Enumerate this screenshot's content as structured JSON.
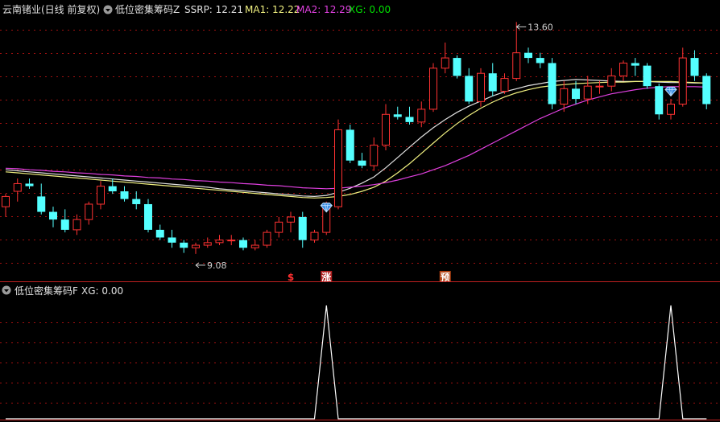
{
  "main_header": {
    "stock": "云南锗业(日线 前复权)",
    "indicator": "低位密集筹码Z",
    "items": [
      {
        "label": "SSRP: 12.21",
        "color": "#e0e0e0"
      },
      {
        "label": "MA1: 12.22",
        "color": "#f0f080"
      },
      {
        "label": "MA2: 12.29",
        "color": "#e040e0"
      },
      {
        "label": "XG: 0.00",
        "color": "#00e000"
      }
    ]
  },
  "sub_header": {
    "indicator": "低位密集筹码F",
    "items": [
      {
        "label": "XG: 0.00",
        "color": "#e0e0e0"
      }
    ]
  },
  "colors": {
    "up": "#ff3232",
    "down": "#54ffff",
    "ma1": "#f0f080",
    "ma2": "#e040e0",
    "ssrp": "#e0e0e0",
    "grid": "#a01010",
    "signal": "#ffffff"
  },
  "annotations": {
    "low": "9.08",
    "high": "13.60",
    "low_index": 16,
    "high_index": 43
  },
  "markers": [
    {
      "text": "$",
      "index": 24,
      "color": "#ff3030"
    },
    {
      "text": "涨",
      "index": 27,
      "color": "#ffffff",
      "bg": "#b02020"
    },
    {
      "text": "预",
      "index": 37,
      "color": "#ffffff",
      "bg": "#b04010"
    }
  ],
  "chart_data": [
    {
      "type": "candlestick",
      "x": [
        0,
        1,
        2,
        3,
        4,
        5,
        6,
        7,
        8,
        9,
        10,
        11,
        12,
        13,
        14,
        15,
        16,
        17,
        18,
        19,
        20,
        21,
        22,
        23,
        24,
        25,
        26,
        27,
        28,
        29,
        30,
        31,
        32,
        33,
        34,
        35,
        36,
        37,
        38,
        39,
        40,
        41,
        42,
        43,
        44,
        45,
        46,
        47,
        48,
        49,
        50,
        51,
        52,
        53,
        54,
        55,
        56,
        57,
        58,
        59
      ],
      "open": [
        10.0,
        10.3,
        10.45,
        10.2,
        9.9,
        9.75,
        9.55,
        9.75,
        10.05,
        10.4,
        10.3,
        10.15,
        10.05,
        9.55,
        9.4,
        9.3,
        9.2,
        9.25,
        9.3,
        9.35,
        9.35,
        9.2,
        9.25,
        9.5,
        9.7,
        9.8,
        9.35,
        9.5,
        10.0,
        11.5,
        10.9,
        10.8,
        11.2,
        11.8,
        11.75,
        11.65,
        11.9,
        12.7,
        12.9,
        12.55,
        12.05,
        12.6,
        12.25,
        12.5,
        13.0,
        12.9,
        12.8,
        12.0,
        12.3,
        12.1,
        12.35,
        12.35,
        12.55,
        12.8,
        12.75,
        12.35,
        11.8,
        12.0,
        12.9,
        12.55
      ],
      "close": [
        10.2,
        10.45,
        10.4,
        9.9,
        9.75,
        9.55,
        9.75,
        10.05,
        10.4,
        10.3,
        10.15,
        10.05,
        9.55,
        9.4,
        9.3,
        9.2,
        9.25,
        9.3,
        9.35,
        9.35,
        9.2,
        9.25,
        9.5,
        9.7,
        9.8,
        9.35,
        9.5,
        10.0,
        11.5,
        10.9,
        10.8,
        11.2,
        11.8,
        11.75,
        11.65,
        11.9,
        12.7,
        12.9,
        12.55,
        12.05,
        12.6,
        12.25,
        12.5,
        13.0,
        12.9,
        12.8,
        12.0,
        12.3,
        12.1,
        12.35,
        12.35,
        12.55,
        12.8,
        12.75,
        12.35,
        11.8,
        12.0,
        12.9,
        12.55,
        12.0
      ],
      "high": [
        10.25,
        10.55,
        10.55,
        10.45,
        10.0,
        9.95,
        9.85,
        10.1,
        10.5,
        10.55,
        10.4,
        10.3,
        10.15,
        9.65,
        9.55,
        9.35,
        9.3,
        9.4,
        9.45,
        9.45,
        9.4,
        9.35,
        9.55,
        9.8,
        9.9,
        9.9,
        9.55,
        10.1,
        11.7,
        11.6,
        11.05,
        11.35,
        12.0,
        11.95,
        11.95,
        12.05,
        12.8,
        13.2,
        12.95,
        12.7,
        12.7,
        12.8,
        12.6,
        13.6,
        13.1,
        13.0,
        12.9,
        12.45,
        12.45,
        12.55,
        12.45,
        12.7,
        12.85,
        12.9,
        12.8,
        12.4,
        12.1,
        13.1,
        13.05,
        12.6
      ],
      "low": [
        9.8,
        10.1,
        10.35,
        9.85,
        9.6,
        9.5,
        9.45,
        9.65,
        9.95,
        10.25,
        10.1,
        9.95,
        9.5,
        9.35,
        9.2,
        9.1,
        9.08,
        9.2,
        9.25,
        9.25,
        9.15,
        9.15,
        9.2,
        9.4,
        9.5,
        9.2,
        9.3,
        9.45,
        9.95,
        10.85,
        10.75,
        10.7,
        11.1,
        11.7,
        11.6,
        11.55,
        11.85,
        12.6,
        12.5,
        12.0,
        11.95,
        12.15,
        12.2,
        12.45,
        12.8,
        12.7,
        11.9,
        11.85,
        12.0,
        12.0,
        12.2,
        12.25,
        12.45,
        12.55,
        12.3,
        11.7,
        11.7,
        11.95,
        12.45,
        11.9
      ]
    },
    {
      "type": "line",
      "x": [
        0,
        1,
        2,
        3,
        4,
        5,
        6,
        7,
        8,
        9,
        10,
        11,
        12,
        13,
        14,
        15,
        16,
        17,
        18,
        19,
        20,
        21,
        22,
        23,
        24,
        25,
        26,
        27,
        28,
        29,
        30,
        31,
        32,
        33,
        34,
        35,
        36,
        37,
        38,
        39,
        40,
        41,
        42,
        43,
        44,
        45,
        46,
        47,
        48,
        49,
        50,
        51,
        52,
        53,
        54,
        55,
        56,
        57,
        58,
        59
      ],
      "series": [
        {
          "name": "SSRP",
          "values": [
            10.72,
            10.7,
            10.68,
            10.66,
            10.64,
            10.62,
            10.6,
            10.58,
            10.56,
            10.54,
            10.52,
            10.5,
            10.48,
            10.46,
            10.44,
            10.42,
            10.4,
            10.38,
            10.35,
            10.33,
            10.31,
            10.29,
            10.27,
            10.25,
            10.23,
            10.21,
            10.2,
            10.22,
            10.28,
            10.36,
            10.46,
            10.58,
            10.76,
            10.96,
            11.16,
            11.36,
            11.54,
            11.7,
            11.84,
            11.96,
            12.06,
            12.16,
            12.24,
            12.3,
            12.36,
            12.4,
            12.44,
            12.46,
            12.48,
            12.47,
            12.46,
            12.45,
            12.44,
            12.44,
            12.44,
            12.43,
            12.42,
            12.42,
            12.41,
            12.41
          ]
        },
        {
          "name": "MA1",
          "values": [
            10.68,
            10.66,
            10.64,
            10.62,
            10.6,
            10.58,
            10.56,
            10.54,
            10.52,
            10.5,
            10.48,
            10.46,
            10.44,
            10.42,
            10.4,
            10.38,
            10.36,
            10.34,
            10.32,
            10.3,
            10.28,
            10.26,
            10.24,
            10.22,
            10.2,
            10.18,
            10.17,
            10.18,
            10.2,
            10.24,
            10.3,
            10.38,
            10.5,
            10.66,
            10.84,
            11.04,
            11.24,
            11.44,
            11.62,
            11.78,
            11.92,
            12.04,
            12.14,
            12.22,
            12.28,
            12.33,
            12.36,
            12.38,
            12.4,
            12.41,
            12.42,
            12.43,
            12.43,
            12.44,
            12.44,
            12.44,
            12.44,
            12.43,
            12.42,
            12.41
          ]
        },
        {
          "name": "MA2",
          "values": [
            10.75,
            10.74,
            10.72,
            10.71,
            10.69,
            10.68,
            10.66,
            10.65,
            10.63,
            10.62,
            10.6,
            10.59,
            10.57,
            10.56,
            10.54,
            10.53,
            10.51,
            10.5,
            10.48,
            10.47,
            10.45,
            10.44,
            10.42,
            10.41,
            10.39,
            10.37,
            10.36,
            10.35,
            10.36,
            10.38,
            10.4,
            10.43,
            10.47,
            10.52,
            10.58,
            10.64,
            10.72,
            10.8,
            10.9,
            11.0,
            11.12,
            11.24,
            11.36,
            11.48,
            11.6,
            11.72,
            11.82,
            11.92,
            12.0,
            12.08,
            12.14,
            12.2,
            12.24,
            12.28,
            12.31,
            12.33,
            12.34,
            12.34,
            12.34,
            12.33
          ]
        }
      ]
    },
    {
      "type": "line",
      "name": "XG",
      "x": [
        0,
        1,
        2,
        3,
        4,
        5,
        6,
        7,
        8,
        9,
        10,
        11,
        12,
        13,
        14,
        15,
        16,
        17,
        18,
        19,
        20,
        21,
        22,
        23,
        24,
        25,
        26,
        27,
        28,
        29,
        30,
        31,
        32,
        33,
        34,
        35,
        36,
        37,
        38,
        39,
        40,
        41,
        42,
        43,
        44,
        45,
        46,
        47,
        48,
        49,
        50,
        51,
        52,
        53,
        54,
        55,
        56,
        57,
        58,
        59
      ],
      "values": [
        0,
        0,
        0,
        0,
        0,
        0,
        0,
        0,
        0,
        0,
        0,
        0,
        0,
        0,
        0,
        0,
        0,
        0,
        0,
        0,
        0,
        0,
        0,
        0,
        0,
        0,
        0,
        1,
        0,
        0,
        0,
        0,
        0,
        0,
        0,
        0,
        0,
        0,
        0,
        0,
        0,
        0,
        0,
        0,
        0,
        0,
        0,
        0,
        0,
        0,
        0,
        0,
        0,
        0,
        0,
        0,
        1,
        0,
        0,
        0
      ],
      "ylim": [
        0,
        1
      ]
    }
  ]
}
